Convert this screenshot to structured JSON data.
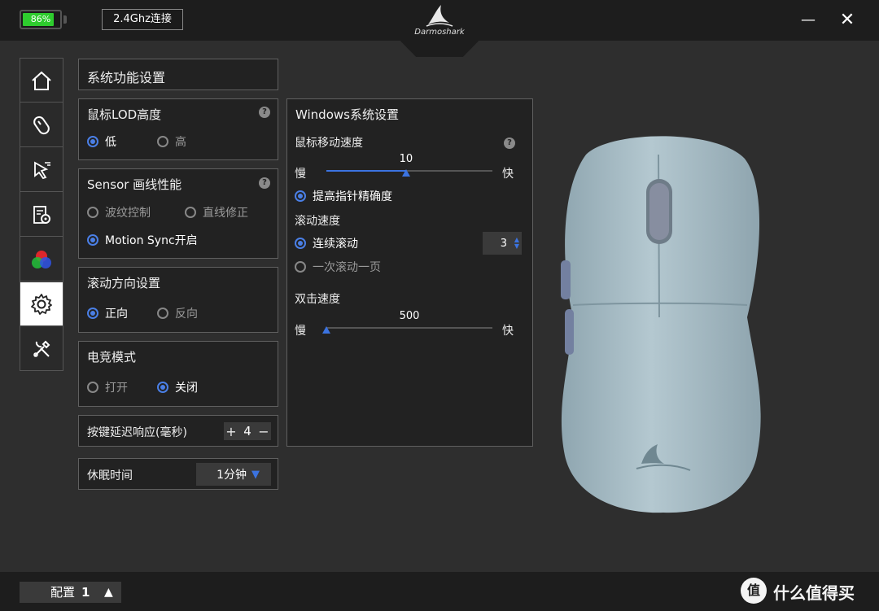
{
  "titlebar": {
    "battery_text": "86%",
    "battery_level": 0.86,
    "connection": "2.4Ghz连接",
    "brand": "Darmoshark",
    "minimize": "—",
    "close": "✕"
  },
  "sidebar": {
    "items": [
      {
        "icon": "home-icon"
      },
      {
        "icon": "mouse-icon"
      },
      {
        "icon": "cursor-icon"
      },
      {
        "icon": "macro-icon"
      },
      {
        "icon": "rgb-icon"
      },
      {
        "icon": "settings-gear-icon",
        "active": true
      },
      {
        "icon": "tools-icon"
      }
    ]
  },
  "system": {
    "title": "系统功能设置",
    "lod": {
      "title": "鼠标LOD高度",
      "help": "?",
      "options": [
        "低",
        "高"
      ],
      "selected": "低"
    },
    "sensor": {
      "title": "Sensor 画线性能",
      "help": "?",
      "options": [
        "波纹控制",
        "直线修正",
        "Motion Sync开启"
      ],
      "selected": "Motion Sync开启"
    },
    "scroll_dir": {
      "title": "滚动方向设置",
      "options": [
        "正向",
        "反向"
      ],
      "selected": "正向"
    },
    "esports": {
      "title": "电竞模式",
      "options": [
        "打开",
        "关闭"
      ],
      "selected": "关闭"
    },
    "debounce": {
      "label": "按键延迟响应(毫秒)",
      "plus": "+",
      "value": "4",
      "minus": "−"
    },
    "sleep": {
      "label": "休眠时间",
      "value": "1分钟",
      "arrow": "▼"
    }
  },
  "windows": {
    "title": "Windows系统设置",
    "pointer_speed": {
      "label": "鼠标移动速度",
      "help": "?",
      "value": "10",
      "fraction": 0.48,
      "slow": "慢",
      "fast": "快"
    },
    "enhance_precision": "提高指针精确度",
    "scroll_speed": {
      "label": "滚动速度",
      "continuous": "连续滚动",
      "lines": "3",
      "page": "一次滚动一页",
      "selected": "连续滚动"
    },
    "double_click": {
      "label": "双击速度",
      "value": "500",
      "fraction": 0.0,
      "slow": "慢",
      "fast": "快"
    }
  },
  "footer": {
    "profile_label": "配置",
    "profile_number": "1",
    "profile_arrow": "▲",
    "watermark": "什么值得买",
    "watermark_badge": "值"
  },
  "colors": {
    "accent": "#3b73e0",
    "battery": "#2ecc2e",
    "mouse_body": "#a4bac4"
  }
}
